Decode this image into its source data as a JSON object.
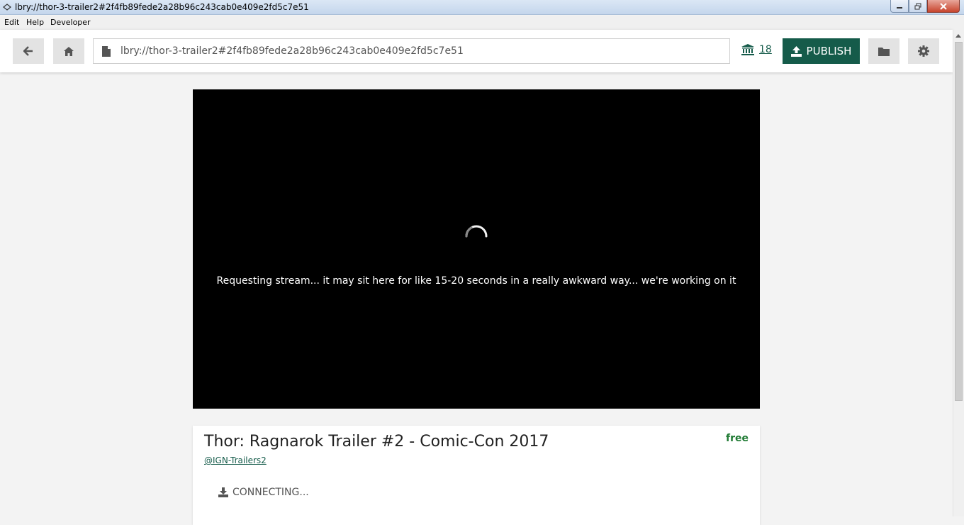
{
  "window": {
    "title": "lbry://thor-3-trailer2#2f4fb89fede2a28b96c243cab0e409e2fd5c7e51"
  },
  "menu": {
    "items": [
      "Edit",
      "Help",
      "Developer"
    ]
  },
  "header": {
    "url_value": "lbry://thor-3-trailer2#2f4fb89fede2a28b96c243cab0e409e2fd5c7e51",
    "wallet_balance": "18",
    "publish_label": "PUBLISH",
    "accent_color": "#155b4a"
  },
  "video": {
    "status_message": "Requesting stream... it may sit here for like 15-20 seconds in a really awkward way... we're working on it"
  },
  "card": {
    "title": "Thor: Ragnarok Trailer #2 - Comic-Con 2017",
    "channel": "@IGN-Trailers2",
    "price": "free",
    "download_status": "CONNECTING..."
  },
  "icons": [
    "back-arrow-icon",
    "home-icon",
    "file-icon",
    "bank-icon",
    "upload-icon",
    "folder-icon",
    "gear-icon",
    "download-icon",
    "loading-spinner-icon"
  ]
}
